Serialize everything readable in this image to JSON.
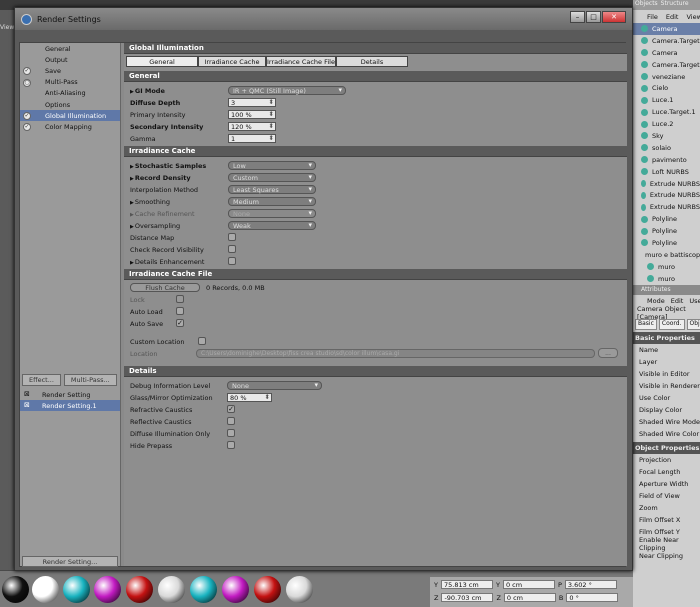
{
  "window": {
    "title": "Render Settings",
    "minimize": "–",
    "maximize": "□",
    "close": "✕"
  },
  "left_strip": {
    "label": "View"
  },
  "left_menu": [
    {
      "label": "General",
      "check": ""
    },
    {
      "label": "Output",
      "check": ""
    },
    {
      "label": "Save",
      "check": "✓"
    },
    {
      "label": "Multi-Pass",
      "check": "○"
    },
    {
      "label": "Anti-Aliasing",
      "check": ""
    },
    {
      "label": "Options",
      "check": ""
    },
    {
      "label": "Global Illumination",
      "check": "✓"
    },
    {
      "label": "Color Mapping",
      "check": "✓"
    }
  ],
  "effect_button": "Effect...",
  "multipass_button": "Multi-Pass...",
  "render_settings_list": [
    {
      "label": "Render Setting",
      "mark": "⊠"
    },
    {
      "label": "Render Setting.1",
      "mark": "⊠"
    }
  ],
  "render_setting_button": "Render Setting...",
  "main": {
    "title": "Global Illumination",
    "tabs": [
      "General",
      "Irradiance Cache",
      "Irradiance Cache File",
      "Details"
    ],
    "general": {
      "header": "General",
      "gi_mode_label": "GI Mode",
      "gi_mode_value": "IR + QMC (Still Image)",
      "diffuse_depth_label": "Diffuse Depth",
      "diffuse_depth_value": "3",
      "primary_intensity_label": "Primary Intensity",
      "primary_intensity_value": "100 %",
      "secondary_intensity_label": "Secondary Intensity",
      "secondary_intensity_value": "120 %",
      "gamma_label": "Gamma",
      "gamma_value": "1"
    },
    "irradiance_cache": {
      "header": "Irradiance Cache",
      "stochastic_label": "Stochastic Samples",
      "stochastic_value": "Low",
      "record_density_label": "Record Density",
      "record_density_value": "Custom",
      "interpolation_label": "Interpolation Method",
      "interpolation_value": "Least Squares",
      "smoothing_label": "Smoothing",
      "smoothing_value": "Medium",
      "cache_refinement_label": "Cache Refinement",
      "cache_refinement_value": "None",
      "oversampling_label": "Oversampling",
      "oversampling_value": "Weak",
      "distance_map_label": "Distance Map",
      "check_record_label": "Check Record Visibility",
      "details_enh_label": "Details Enhancement"
    },
    "irradiance_file": {
      "header": "Irradiance Cache File",
      "flush_button": "Flush Cache",
      "records_text": "0 Records, 0.0 MB",
      "lock_label": "Lock",
      "auto_load_label": "Auto Load",
      "auto_save_label": "Auto Save",
      "custom_location_label": "Custom Location",
      "location_label": "Location",
      "location_value": "C:\\Users\\dominighe\\Desktop\\fiss crea studio\\sd\\color illum\\casa.gi",
      "location_button": "..."
    },
    "details": {
      "header": "Details",
      "debug_label": "Debug Information Level",
      "debug_value": "None",
      "glass_label": "Glass/Mirror Optimization",
      "glass_value": "80 %",
      "refractive_label": "Refractive Caustics",
      "reflective_label": "Reflective Caustics",
      "diffuse_illum_label": "Diffuse Illumination Only",
      "hide_prepass_label": "Hide Prepass"
    }
  },
  "right_panel": {
    "tabs": [
      "Objects",
      "Structure"
    ],
    "menu": [
      "File",
      "Edit",
      "View"
    ],
    "objects": [
      "Camera",
      "Camera.Target",
      "Camera",
      "Camera.Target",
      "veneziane",
      "Cielo",
      "Luce.1",
      "Luce.Target.1",
      "Luce.2",
      "Sky",
      "solaio",
      "pavimento",
      "Loft NURBS",
      "Extrude NURBS",
      "Extrude NURBS",
      "Extrude NURBS",
      "Polyline",
      "Polyline",
      "Polyline",
      "muro e battiscopa",
      "muro",
      "muro"
    ],
    "attributes_header": "Attributes",
    "attr_menu": [
      "Mode",
      "Edit",
      "User"
    ],
    "attr_title": "Camera Object [Camera]",
    "attr_tabs": [
      "Basic",
      "Coord.",
      "Object"
    ],
    "basic_header": "Basic Properties",
    "basic_props": [
      "Name",
      "Layer",
      "Visible in Editor",
      "Visible in Renderer",
      "Use Color",
      "Display Color",
      "Shaded Wire Mode",
      "Shaded Wire Color"
    ],
    "object_header": "Object Properties",
    "object_props": [
      "Projection",
      "Focal Length",
      "Aperture Width",
      "Field of View",
      "Zoom",
      "Film Offset X",
      "Film Offset Y",
      "Enable Near Clipping",
      "Near Clipping"
    ]
  },
  "coords": {
    "y_label": "Y",
    "y_value": "75.813 cm",
    "y2_label": "Y",
    "y2_value": "0 cm",
    "p_label": "P",
    "p_value": "3.602 °",
    "z_label": "Z",
    "z_value": "-90.703 cm",
    "z2_label": "Z",
    "z2_value": "0 cm",
    "b_label": "B",
    "b_value": "0 °"
  },
  "colors": {
    "selection": "#5f78a8",
    "header": "#5a5a5a",
    "ball_colors": [
      "#111111",
      "#ffffff",
      "#19b3c0",
      "#c21bc2",
      "#c41212",
      "#d9d9d9",
      "#19b3c0",
      "#c21bc2",
      "#c41212",
      "#d9d9d9"
    ]
  }
}
